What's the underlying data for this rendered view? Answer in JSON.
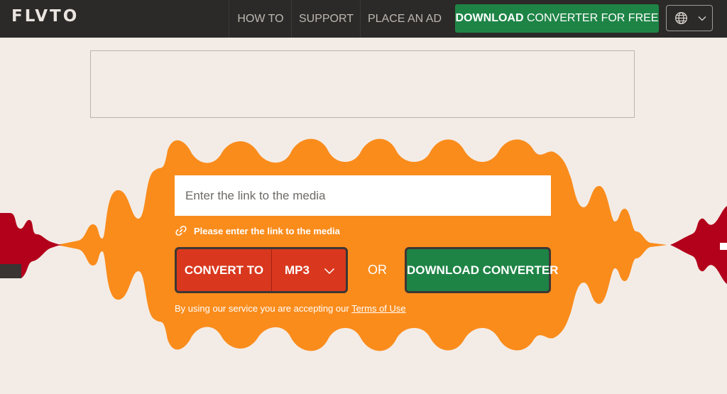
{
  "header": {
    "logo": "FLVTO",
    "nav": [
      "HOW TO",
      "SUPPORT",
      "PLACE AN AD"
    ],
    "download_bold": "DOWNLOAD",
    "download_rest": " CONVERTER FOR FREE",
    "language_icon": "globe-icon"
  },
  "converter": {
    "input_placeholder": "Enter the link to the media",
    "hint": "Please enter the link to the media",
    "convert_label": "CONVERT TO",
    "format": "MP3",
    "or": "OR",
    "download_label": "DOWNLOAD CONVERTER",
    "terms_prefix": "By using our service you are accepting our ",
    "terms_link": "Terms of Use"
  },
  "colors": {
    "header_bg": "#2c2a28",
    "page_bg": "#f3ece6",
    "wave_orange": "#fa8c1c",
    "wave_red": "#b3001b",
    "convert_red": "#d9381e",
    "download_green": "#1e8446"
  }
}
